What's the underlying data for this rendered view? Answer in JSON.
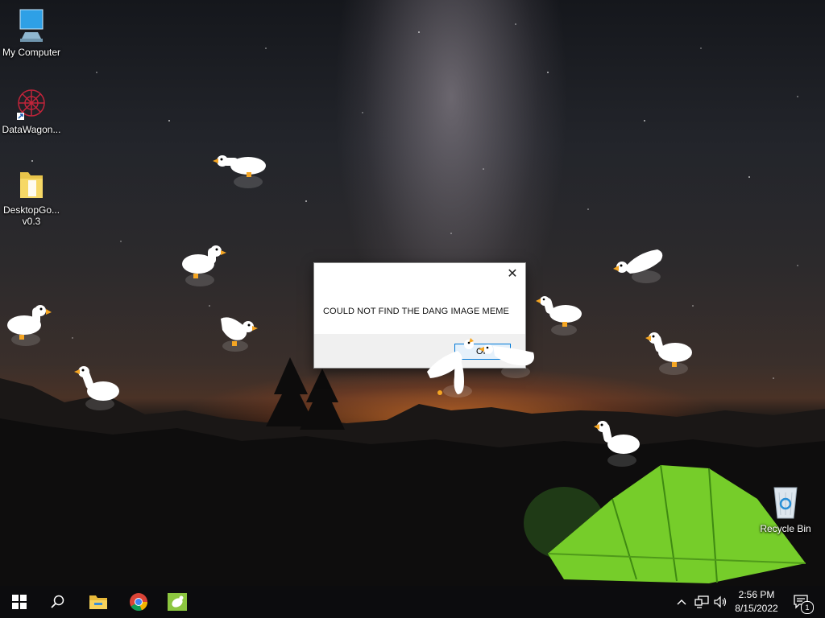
{
  "desktop": {
    "icons": [
      {
        "label": "My Computer",
        "icon": "computer-icon"
      },
      {
        "label": "DataWagon...",
        "icon": "datawagon-icon"
      },
      {
        "label": "DesktopGo... v0.3",
        "icon": "folder-icon"
      },
      {
        "label": "Recycle Bin",
        "icon": "recycle-bin-icon"
      }
    ]
  },
  "dialog": {
    "message": "COULD NOT FIND THE DANG IMAGE MEME",
    "ok_label": "OK",
    "close_icon": "close-icon"
  },
  "taskbar": {
    "start_icon": "windows-start-icon",
    "search_icon": "search-icon",
    "pinned": [
      "file-explorer-icon",
      "chrome-icon",
      "goose-app-icon"
    ],
    "tray": {
      "chevron_icon": "chevron-up-icon",
      "network_icon": "network-icon",
      "volume_icon": "volume-icon",
      "time": "2:56 PM",
      "date": "8/15/2022",
      "notification_count": "1"
    }
  },
  "colors": {
    "goose_body": "#ffffff",
    "goose_beak": "#f5a623",
    "tent": "#7bd32a",
    "dialog_accent": "#0078d7"
  }
}
